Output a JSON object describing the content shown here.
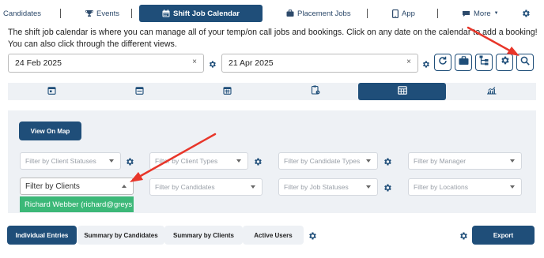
{
  "nav": {
    "items": [
      {
        "label": "Candidates",
        "icon": "none"
      },
      {
        "label": "Events",
        "icon": "trophy-icon"
      },
      {
        "label": "Shift Job Calendar",
        "icon": "calendar-icon"
      },
      {
        "label": "Placement Jobs",
        "icon": "briefcase-icon"
      },
      {
        "label": "App",
        "icon": "phone-icon"
      },
      {
        "label": "More",
        "icon": "comment-icon"
      }
    ]
  },
  "intro_text": "The shift job calendar is where you can manage all of your temp/on call jobs and bookings. Click on any date on the calendar to add a booking! You can also click through the different views.",
  "dates": {
    "start": "24 Feb 2025",
    "end": "21 Apr 2025",
    "clear_symbol": "×"
  },
  "toolbar_icons": [
    "refresh-icon",
    "briefcase-icon",
    "hierarchy-icon",
    "gear-icon",
    "search-icon"
  ],
  "view_tabs": [
    "day-view",
    "week-view",
    "month-view",
    "clipboard-view",
    "table-view",
    "chart-view"
  ],
  "active_view_tab": 4,
  "map_button": "View On Map",
  "filters": {
    "client_statuses": "Filter by Client Statuses",
    "client_types": "Filter by Client Types",
    "candidate_types": "Filter by Candidate Types",
    "manager": "Filter by Manager",
    "clients": "Filter by Clients",
    "candidates": "Filter by Candidates",
    "job_statuses": "Filter by Job Statuses",
    "locations": "Filter by Locations"
  },
  "clients_dropdown_option": "Richard Webber (richard@greys",
  "bottom_tabs": [
    "Individual Entries",
    "Summary by Candidates",
    "Summary by Clients",
    "Active Users"
  ],
  "export_button": "Export",
  "colors": {
    "primary": "#1f4e79",
    "panel": "#eef1f5",
    "highlight": "#3cb878",
    "annotation_arrow": "#e8362a"
  }
}
